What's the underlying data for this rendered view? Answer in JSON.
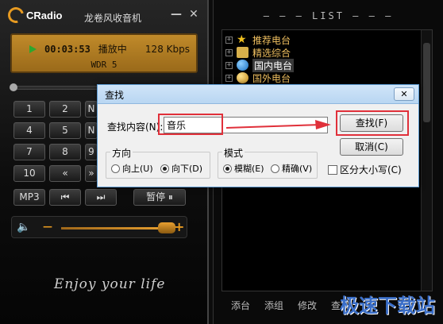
{
  "player": {
    "logo": "CRadio",
    "title": "龙卷风收音机",
    "minimize": "—",
    "close": "✕",
    "lcd": {
      "time": "00:03:53",
      "status": "播放中",
      "bitrate": "128 Kbps",
      "station": "WDR 5"
    },
    "keys": [
      {
        "label": "1"
      },
      {
        "label": "2"
      },
      {
        "label": "N"
      },
      {
        "label": "4"
      },
      {
        "label": "5"
      },
      {
        "label": "N"
      },
      {
        "label": "7"
      },
      {
        "label": "8"
      },
      {
        "label": "9"
      },
      {
        "label": "10"
      },
      {
        "label": "«"
      },
      {
        "label": "»"
      }
    ],
    "mp3": "MP3",
    "prev": "⏮",
    "next": "⏭",
    "pause": "暂停 ⏸",
    "volume": {
      "minus": "—",
      "plus": "+",
      "level_fraction": 0.78
    },
    "motto": "Enjoy your life"
  },
  "list": {
    "title": "LIST",
    "items": [
      {
        "label": "推荐电台",
        "icon": "star-icon"
      },
      {
        "label": "精选综合",
        "icon": "folder-icon"
      },
      {
        "label": "国内电台",
        "icon": "globe-icon"
      },
      {
        "label": "国外电台",
        "icon": "globe-icon"
      }
    ],
    "toggle": "+",
    "bottom": [
      "添台",
      "添组",
      "修改",
      "查找"
    ],
    "watermark": "极速下载站"
  },
  "dialog": {
    "title": "查找",
    "close": "✕",
    "find_label": "查找内容(N):",
    "find_value": "音乐",
    "find_button": "查找(F)",
    "cancel_button": "取消(C)",
    "direction": {
      "legend": "方向",
      "up": "向上(U)",
      "down": "向下(D)",
      "selected": "down"
    },
    "mode": {
      "legend": "模式",
      "fuzzy": "模糊(E)",
      "exact": "精确(V)",
      "selected": "fuzzy"
    },
    "case_sensitive": {
      "label": "区分大小写(C)",
      "checked": false
    }
  },
  "colors": {
    "accent": "#e69a21",
    "annotation": "#e0303a",
    "dialog_border": "#5d9ad1"
  }
}
